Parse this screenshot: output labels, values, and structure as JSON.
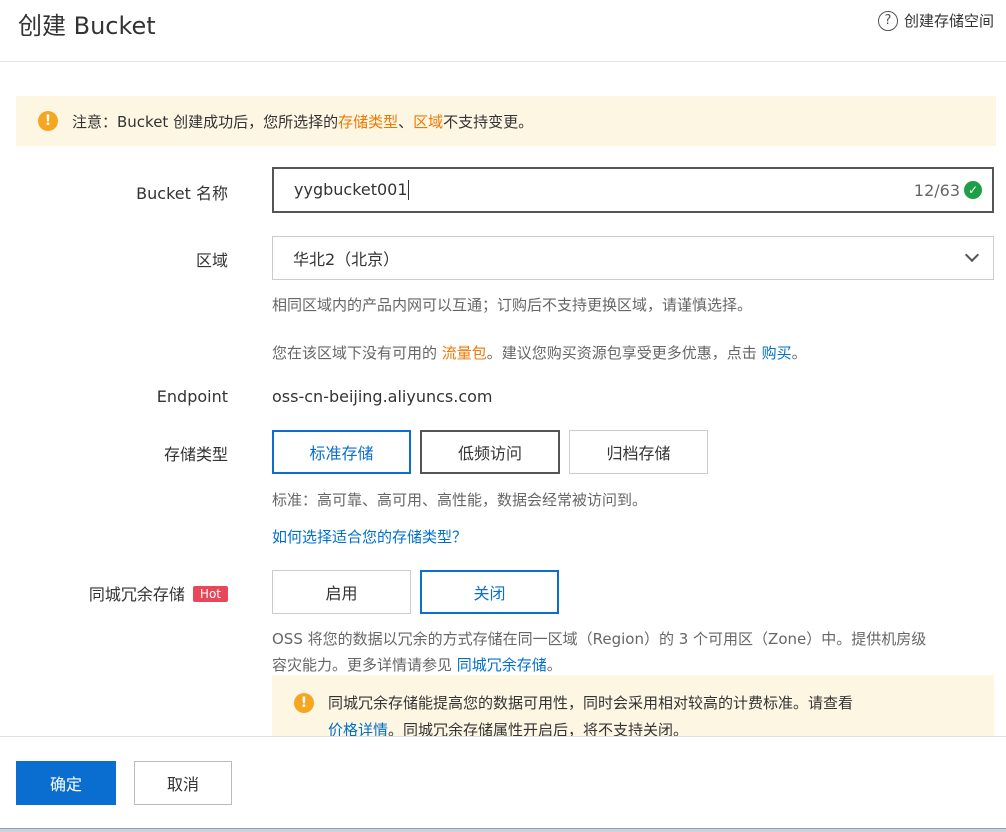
{
  "header": {
    "title": "创建 Bucket",
    "help_label": "创建存储空间"
  },
  "notice": {
    "prefix": "注意：Bucket 创建成功后，您所选择的 ",
    "link_storage_type": "存储类型",
    "sep": "、",
    "link_region": "区域",
    "suffix": " 不支持变更。"
  },
  "bucket_name": {
    "label": "Bucket 名称",
    "value": "yygbucket001",
    "counter": "12/63"
  },
  "region": {
    "label": "区域",
    "selected": "华北2（北京）",
    "hint1": "相同区域内的产品内网可以互通；订购后不支持更换区域，请谨慎选择。",
    "hint2_prefix": "您在该区域下没有可用的 ",
    "hint2_link": "流量包",
    "hint2_mid": "。建议您购买资源包享受更多优惠，点击 ",
    "hint2_buy": "购买",
    "hint2_end": "。"
  },
  "endpoint": {
    "label": "Endpoint",
    "value": "oss-cn-beijing.aliyuncs.com"
  },
  "storage_type": {
    "label": "存储类型",
    "options": [
      "标准存储",
      "低频访问",
      "归档存储"
    ],
    "selected": "标准存储",
    "desc": "标准：高可靠、高可用、高性能，数据会经常被访问到。",
    "help_link": "如何选择适合您的存储类型？"
  },
  "zone_redundancy": {
    "label": "同城冗余存储",
    "badge": "Hot",
    "options": [
      "启用",
      "关闭"
    ],
    "selected": "关闭",
    "desc_line1": "OSS 将您的数据以冗余的方式存储在同一区域（Region）的 3 个可用区（Zone）中。提供机房级",
    "desc_line2_prefix": "容灾能力。更多详情请参见 ",
    "desc_link": "同城冗余存储",
    "desc_line2_end": "。",
    "warn_line1": "同城冗余存储能提高您的数据可用性，同时会采用相对较高的计费标准。请查看",
    "warn_link": "价格详情",
    "warn_line2_rest": "。同城冗余存储属性开启后，将不支持关闭。"
  },
  "footer": {
    "confirm": "确定",
    "cancel": "取消"
  },
  "colors": {
    "primary": "#0a6ed1",
    "link": "#0070cc",
    "accent_orange": "#f07800",
    "notice_bg": "#fdf6e3",
    "hot_badge": "#e8475a",
    "success": "#1e9f47"
  },
  "icons": {
    "help": "question-circle-icon",
    "warning": "exclamation-circle-icon",
    "valid": "check-circle-icon",
    "dropdown": "chevron-down-icon"
  }
}
